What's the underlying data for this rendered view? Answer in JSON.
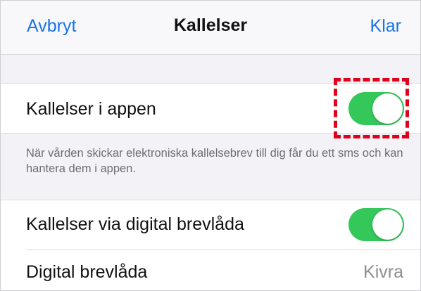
{
  "navbar": {
    "cancel_label": "Avbryt",
    "title": "Kallelser",
    "done_label": "Klar"
  },
  "settings": {
    "app_notices": {
      "label": "Kallelser i appen",
      "toggle_on": true,
      "footer": "När vården skickar elektroniska kallelsebrev till dig får du ett sms och kan hantera dem i appen."
    },
    "digital_mailbox_notices": {
      "label": "Kallelser via digital brevlåda",
      "toggle_on": true
    },
    "digital_mailbox": {
      "label": "Digital brevlåda",
      "value": "Kivra"
    }
  },
  "colors": {
    "accent": "#1a73e8",
    "toggle_on": "#34c759",
    "highlight": "#e0001b"
  }
}
